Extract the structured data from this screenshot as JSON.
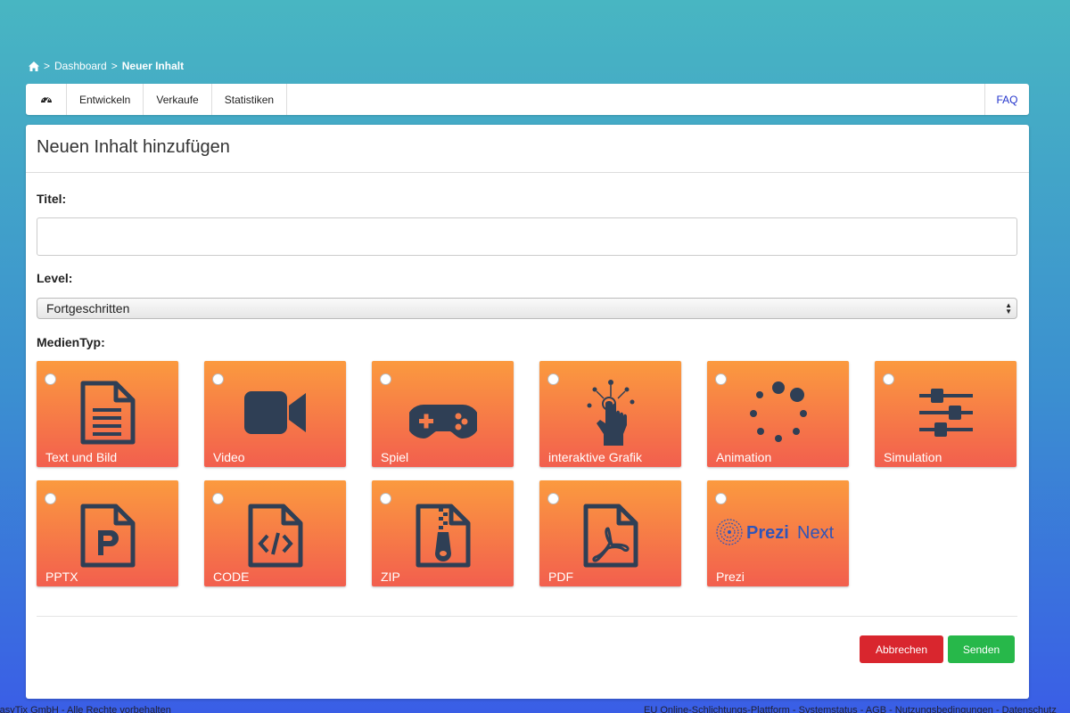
{
  "breadcrumb": {
    "separator1": ">",
    "dashboard": "Dashboard",
    "separator2": ">",
    "current": "Neuer Inhalt"
  },
  "nav": {
    "items": [
      "Entwickeln",
      "Verkaufe",
      "Statistiken"
    ],
    "faq": "FAQ"
  },
  "form": {
    "heading": "Neuen Inhalt hinzufügen",
    "title_label": "Titel:",
    "title_value": "",
    "level_label": "Level:",
    "level_value": "Fortgeschritten",
    "media_label": "MedienTyp:",
    "media_types": [
      {
        "label": "Text und Bild",
        "icon": "document-icon"
      },
      {
        "label": "Video",
        "icon": "video-camera-icon"
      },
      {
        "label": "Spiel",
        "icon": "gamepad-icon"
      },
      {
        "label": "interaktive Grafik",
        "icon": "touch-hand-icon"
      },
      {
        "label": "Animation",
        "icon": "spinner-icon"
      },
      {
        "label": "Simulation",
        "icon": "sliders-icon"
      },
      {
        "label": "PPTX",
        "icon": "pptx-file-icon"
      },
      {
        "label": "CODE",
        "icon": "code-file-icon"
      },
      {
        "label": "ZIP",
        "icon": "zip-file-icon"
      },
      {
        "label": "PDF",
        "icon": "pdf-file-icon"
      },
      {
        "label": "Prezi",
        "icon": "prezi-logo",
        "logo_text_1": "Prezi",
        "logo_text_2": "Next"
      }
    ]
  },
  "buttons": {
    "cancel": "Abbrechen",
    "send": "Senden"
  },
  "footer": {
    "left": "rasyTix GmbH - Alle Rechte vorbehalten",
    "right": "EU Online-Schlichtungs-Plattform - Systemstatus - AGB - Nutzungsbedingungen - Datenschutz"
  },
  "colors": {
    "tile_top": "#fb9a3f",
    "tile_bottom": "#f25f4e",
    "icon": "#2f3f55",
    "cancel": "#d9262e",
    "send": "#27b84a",
    "faq": "#2233cc"
  }
}
